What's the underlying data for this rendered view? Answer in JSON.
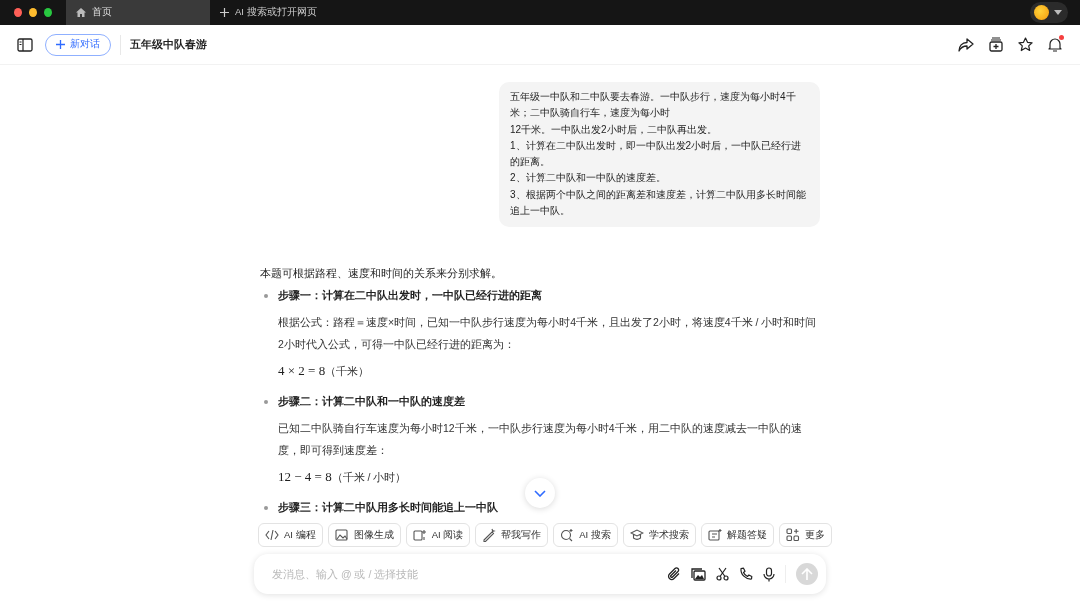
{
  "tabs": [
    {
      "label": "首页",
      "selected": true
    },
    {
      "label": "AI 搜索或打开网页",
      "selected": false
    }
  ],
  "header": {
    "new_chat": "新对话",
    "title": "五年级中队春游",
    "notification_dot": true
  },
  "user_message": [
    "五年级一中队和二中队要去春游。一中队步行，速度为每小时4千米；二中队骑自行车，速度为每小时",
    "12千米。一中队出发2小时后，二中队再出发。",
    "1、计算在二中队出发时，即一中队出发2小时后，一中队已经行进的距离。",
    "2、计算二中队和一中队的速度差。",
    "3、根据两个中队之间的距离差和速度差，计算二中队用多长时间能追上一中队。"
  ],
  "answer": {
    "intro": "本题可根据路程、速度和时间的关系来分别求解。",
    "steps": [
      {
        "title": "步骤一：计算在二中队出发时，一中队已经行进的距离",
        "body": "根据公式：路程＝速度×时间，已知一中队步行速度为每小时4千米，且出发了2小时，将速度4千米 / 小时和时间2小时代入公式，可得一中队已经行进的距离为：",
        "formula": "4 × 2 = 8",
        "unit": "（千米）"
      },
      {
        "title": "步骤二：计算二中队和一中队的速度差",
        "body": "已知二中队骑自行车速度为每小时12千米，一中队步行速度为每小时4千米，用二中队的速度减去一中队的速度，即可得到速度差：",
        "formula": "12 − 4 = 8",
        "unit": "（千米 / 小时）"
      },
      {
        "title": "步骤三：计算二中队用多长时间能追上一中队"
      }
    ]
  },
  "skills": [
    {
      "label": "AI 编程",
      "kind": "code"
    },
    {
      "label": "图像生成",
      "kind": "image"
    },
    {
      "label": "AI 阅读",
      "kind": "read"
    },
    {
      "label": "帮我写作",
      "kind": "write"
    },
    {
      "label": "AI 搜索",
      "kind": "search"
    },
    {
      "label": "学术搜索",
      "kind": "academic"
    },
    {
      "label": "解题答疑",
      "kind": "solve"
    },
    {
      "label": "更多",
      "kind": "more"
    }
  ],
  "composer": {
    "placeholder": "发消息、输入 @ 或 / 选择技能"
  }
}
